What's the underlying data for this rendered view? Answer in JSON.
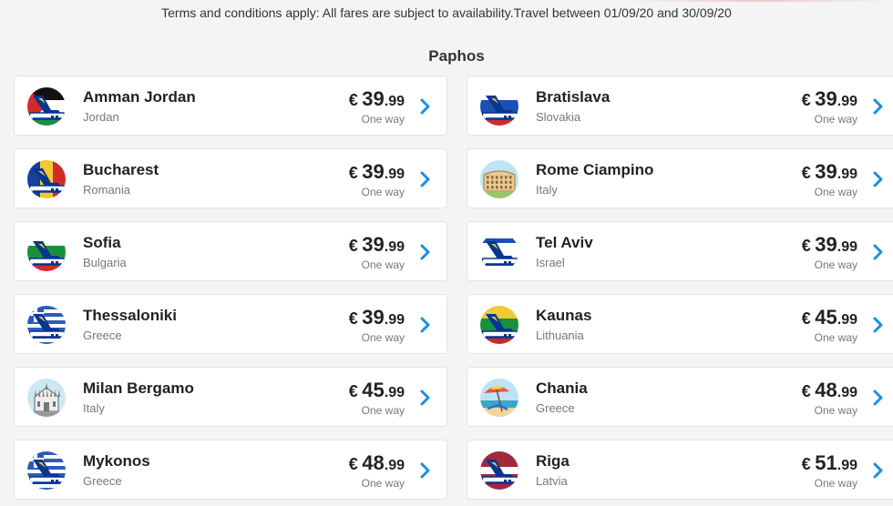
{
  "terms": "Terms and conditions apply: All fares are subject to availability.Travel between 01/09/20 and 30/09/20",
  "origin": "Paphos",
  "currency": "€",
  "fare_type": "One way",
  "destinations": [
    {
      "name": "Amman Jordan",
      "country": "Jordan",
      "price_int": "39",
      "price_dec": ".99",
      "icon": "jordan-flag-plane-icon"
    },
    {
      "name": "Bratislava",
      "country": "Slovakia",
      "price_int": "39",
      "price_dec": ".99",
      "icon": "slovakia-flag-plane-icon"
    },
    {
      "name": "Bucharest",
      "country": "Romania",
      "price_int": "39",
      "price_dec": ".99",
      "icon": "romania-flag-plane-icon"
    },
    {
      "name": "Rome Ciampino",
      "country": "Italy",
      "price_int": "39",
      "price_dec": ".99",
      "icon": "colosseum-icon"
    },
    {
      "name": "Sofia",
      "country": "Bulgaria",
      "price_int": "39",
      "price_dec": ".99",
      "icon": "bulgaria-flag-plane-icon"
    },
    {
      "name": "Tel Aviv",
      "country": "Israel",
      "price_int": "39",
      "price_dec": ".99",
      "icon": "israel-flag-plane-icon"
    },
    {
      "name": "Thessaloniki",
      "country": "Greece",
      "price_int": "39",
      "price_dec": ".99",
      "icon": "greece-flag-plane-icon"
    },
    {
      "name": "Kaunas",
      "country": "Lithuania",
      "price_int": "45",
      "price_dec": ".99",
      "icon": "lithuania-flag-plane-icon"
    },
    {
      "name": "Milan Bergamo",
      "country": "Italy",
      "price_int": "45",
      "price_dec": ".99",
      "icon": "milan-cathedral-icon"
    },
    {
      "name": "Chania",
      "country": "Greece",
      "price_int": "48",
      "price_dec": ".99",
      "icon": "beach-umbrella-icon"
    },
    {
      "name": "Mykonos",
      "country": "Greece",
      "price_int": "48",
      "price_dec": ".99",
      "icon": "greece-flag-plane-icon"
    },
    {
      "name": "Riga",
      "country": "Latvia",
      "price_int": "51",
      "price_dec": ".99",
      "icon": "latvia-flag-plane-icon"
    }
  ],
  "colors": {
    "chevron": "#1a8fe3",
    "card_bg": "#ffffff",
    "page_bg": "#f4f4f4",
    "plane_navy": "#073590",
    "plane_yellow": "#f1c933"
  }
}
